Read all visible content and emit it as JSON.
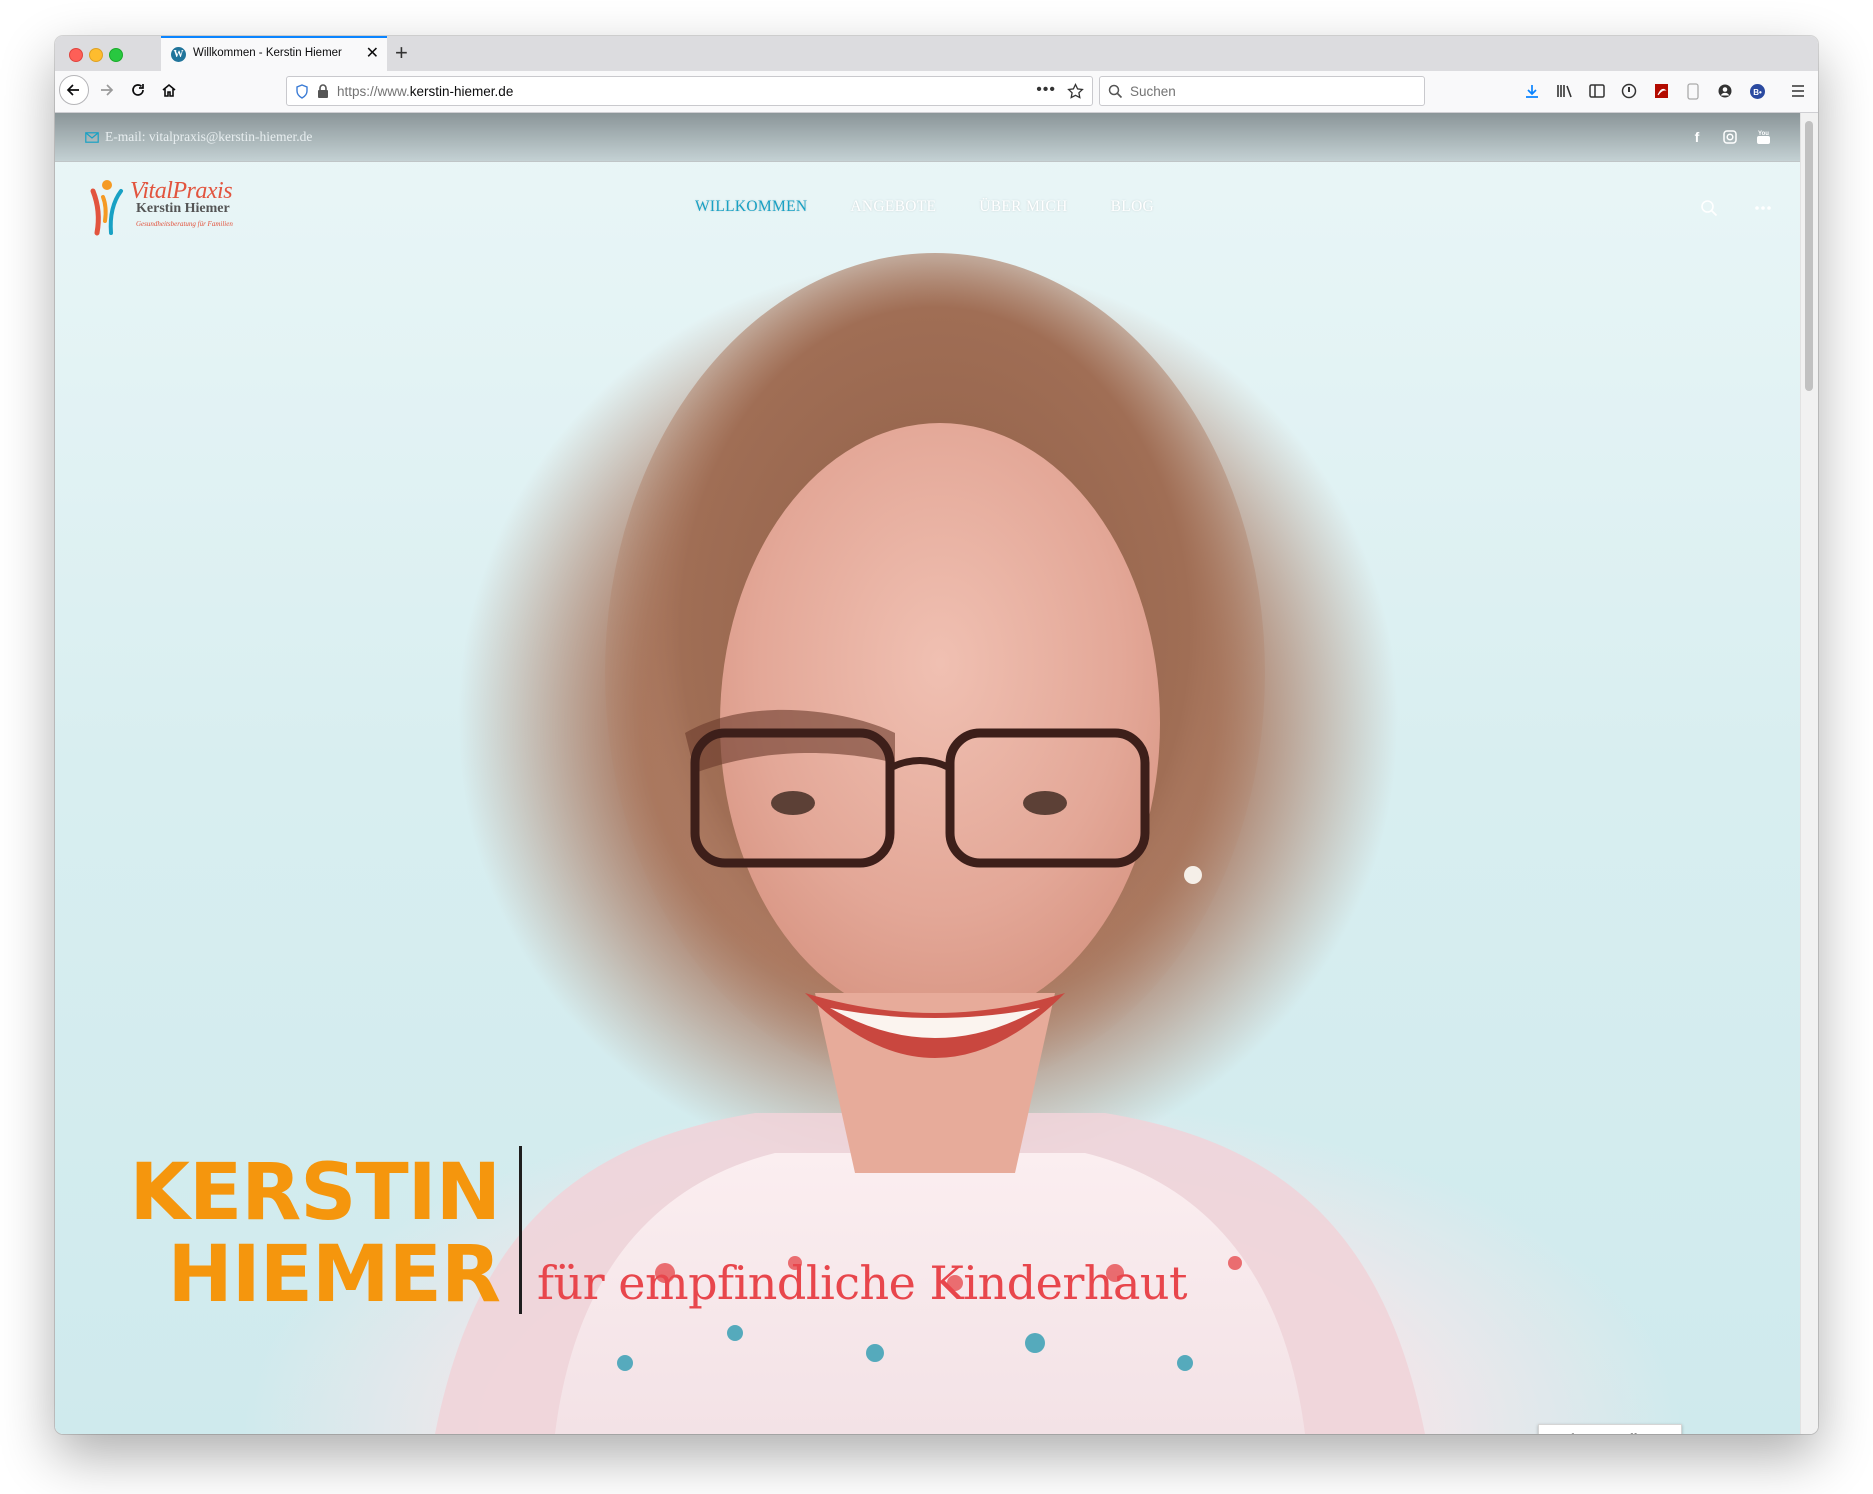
{
  "browser": {
    "tab_title": "Willkommen - Kerstin Hiemer",
    "url_prefix": "https://www.",
    "url_domain": "kerstin-hiemer.de",
    "search_placeholder": "Suchen",
    "favicon_letter": "W"
  },
  "site": {
    "topbar_email": "E-mail: vitalpraxis@kerstin-hiemer.de",
    "logo_word": "VitalPraxis",
    "logo_name": "Kerstin Hiemer",
    "logo_tagline": "Gesundheitsberatung für Familien",
    "nav": [
      {
        "label": "WILLKOMMEN",
        "active": true
      },
      {
        "label": "ANGEBOTE",
        "active": false
      },
      {
        "label": "ÜBER MICH",
        "active": false
      },
      {
        "label": "BLOG",
        "active": false
      }
    ],
    "hero_first": "KERSTIN",
    "hero_last": "HIEMER",
    "hero_subtitle": "für empfindliche Kinderhaut",
    "cookie_button": "Cookies Einstellungen"
  },
  "colors": {
    "accent_nav": "#18a1c4",
    "hero_name": "#f5960d",
    "hero_subtitle": "#e8464c"
  },
  "icons": [
    "back-arrow-icon",
    "forward-arrow-icon",
    "reload-icon",
    "home-icon",
    "shield-icon",
    "lock-icon",
    "more-dots-icon",
    "star-icon",
    "search-icon",
    "download-icon",
    "library-icon",
    "sidebar-icon",
    "extension-icon",
    "pdf-icon",
    "phone-icon",
    "account-icon",
    "addon-icon",
    "menu-icon",
    "mail-icon",
    "facebook-icon",
    "instagram-icon",
    "youtube-icon",
    "site-search-icon",
    "site-more-icon"
  ]
}
